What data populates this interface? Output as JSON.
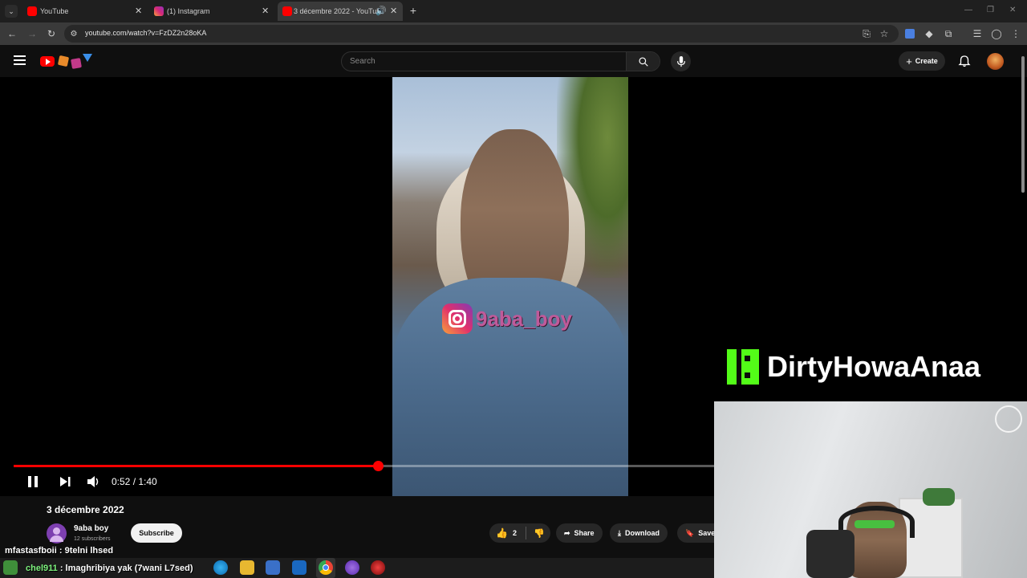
{
  "browser": {
    "tabs": [
      {
        "title": "YouTube",
        "active": false
      },
      {
        "title": "(1) Instagram",
        "active": false
      },
      {
        "title": "3 décembre 2022 - YouTub",
        "active": true,
        "audio": true
      }
    ],
    "url": "youtube.com/watch?v=FzDZ2n28oKA"
  },
  "youtube": {
    "search_placeholder": "Search",
    "create_label": "Create",
    "player": {
      "time": "0:52 / 1:40",
      "progress_fraction": 0.52,
      "watermark_text": "9aba_boy"
    },
    "video": {
      "title": "3 décembre 2022",
      "channel": "9aba boy",
      "subscribers": "12 subscribers",
      "subscribe_label": "Subscribe",
      "likes": "2",
      "share_label": "Share",
      "download_label": "Download",
      "save_label": "Save"
    }
  },
  "stream_overlay": {
    "brand_name": "DirtyHowaAnaa",
    "chat": [
      {
        "user": "mfastasfboii",
        "message": " : 9telni lhsed"
      },
      {
        "user": "chel911",
        "message": " : lmaghribiya yak (7wani L7sed)"
      }
    ]
  },
  "colors": {
    "accent_red": "#ff0000",
    "kick_green": "#53fc18",
    "header_bg": "#0f0f0f"
  }
}
